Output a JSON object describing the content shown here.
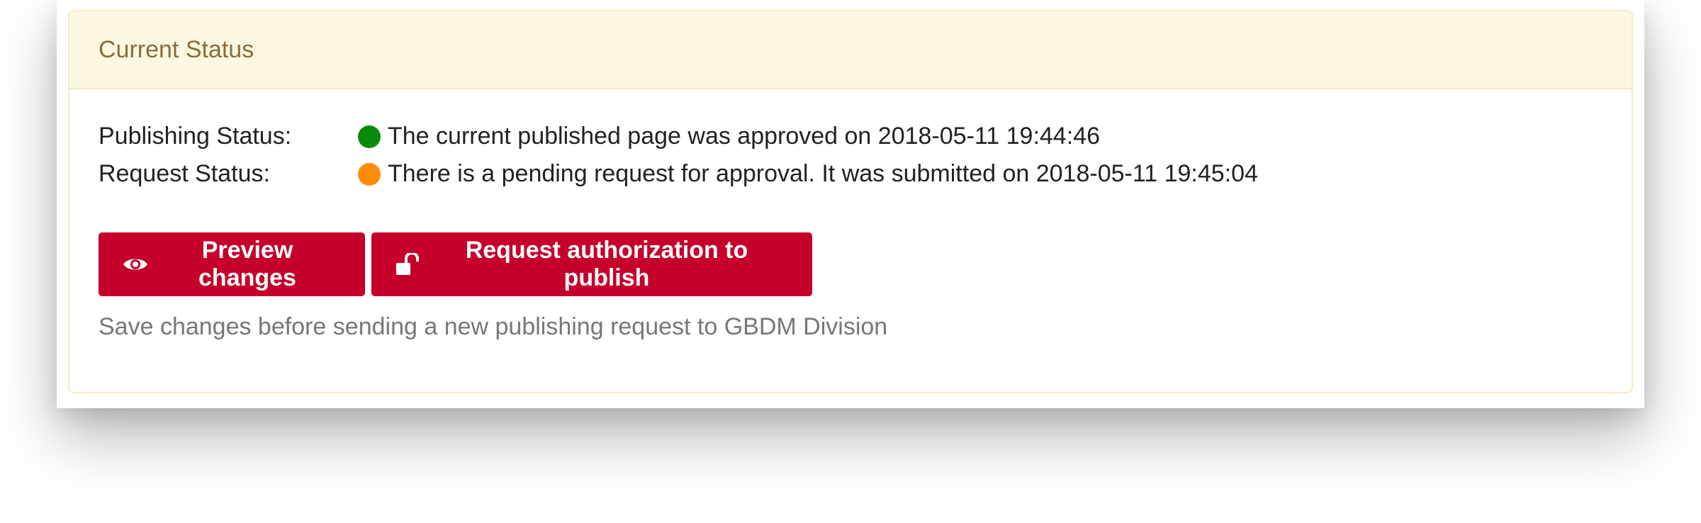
{
  "panel": {
    "title": "Current Status"
  },
  "status": {
    "publishing": {
      "label": "Publishing Status:",
      "text": "The current published page was approved on 2018-05-11 19:44:46",
      "color": "#0a8a0a"
    },
    "request": {
      "label": "Request Status:",
      "text": "There is a pending request for approval. It was submitted on 2018-05-11 19:45:04",
      "color": "#ff8c0a"
    }
  },
  "actions": {
    "preview_label": "Preview changes",
    "preview_icon": "eye-icon",
    "request_label": "Request authorization to publish",
    "request_icon": "unlock-icon",
    "button_color": "#c4002b"
  },
  "help_text": "Save changes before sending a new publishing request to GBDM Division"
}
